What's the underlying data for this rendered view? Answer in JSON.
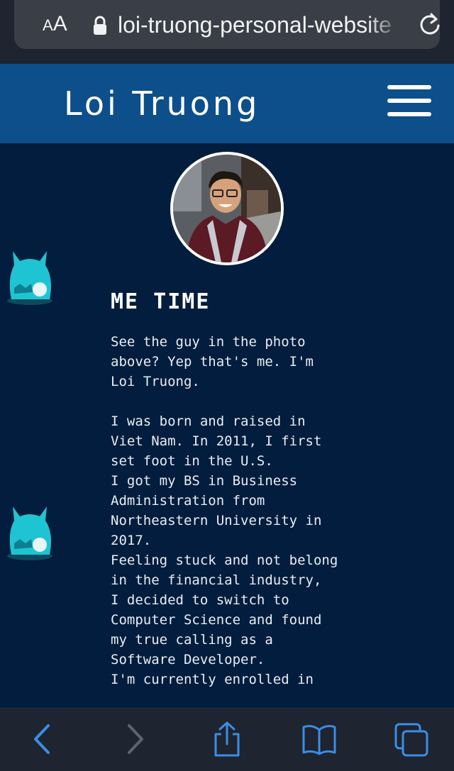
{
  "browser": {
    "aa_label": "AA",
    "url": "loi-truong-personal-website",
    "accent": "#3a8ee6"
  },
  "header": {
    "title": "Loi Truong",
    "background": "#0d4f8a"
  },
  "about": {
    "heading": "ME TIME",
    "body": "See the guy in the photo above? Yep that's me. I'm Loi Truong.\n\nI was born and raised in Viet Nam. In 2011, I first set foot in the U.S.\nI got my BS in Business Administration from Northeastern University in 2017.\nFeeling stuck and not belong in the financial industry,\nI decided to switch to Computer Science and found my true calling as a Software Developer.\nI'm currently enrolled in"
  },
  "icons": {
    "back": "chevron-left-icon",
    "forward": "chevron-right-icon",
    "share": "share-icon",
    "bookmarks": "book-icon",
    "tabs": "tabs-icon"
  }
}
